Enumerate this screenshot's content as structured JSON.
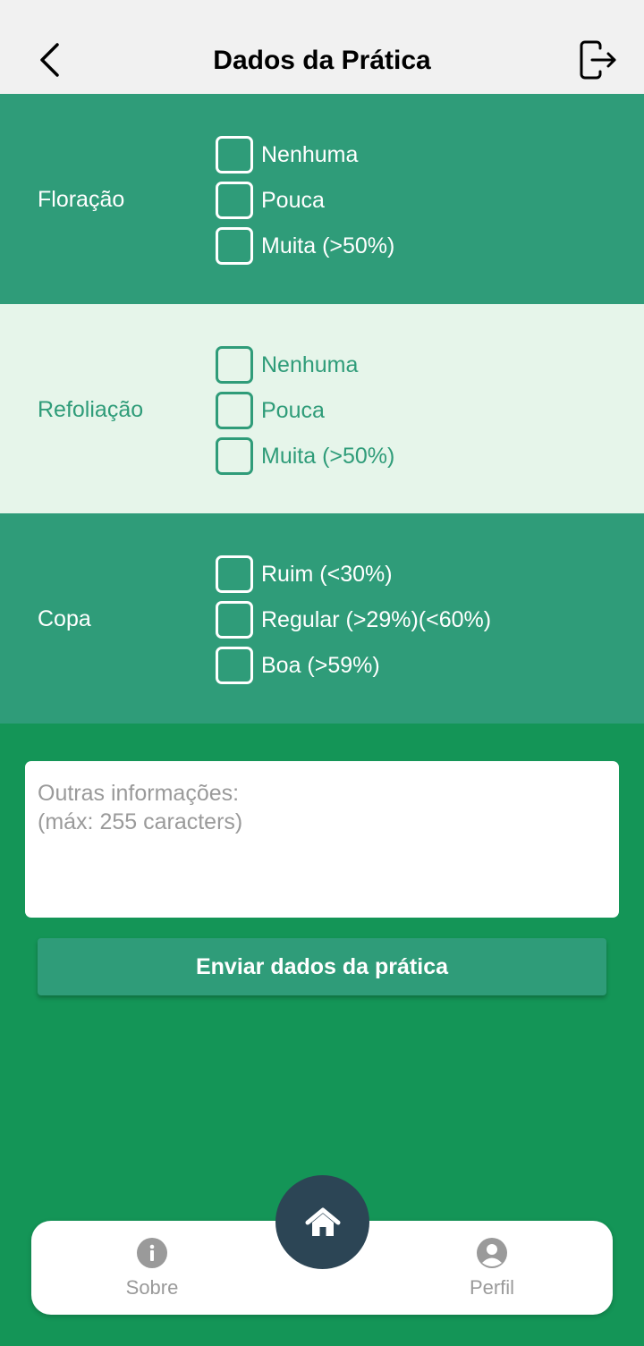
{
  "header": {
    "title": "Dados da Prática"
  },
  "sections": [
    {
      "label": "Floração",
      "options": [
        "Nenhuma",
        "Pouca",
        "Muita (>50%)"
      ]
    },
    {
      "label": "Refoliação",
      "options": [
        "Nenhuma",
        "Pouca",
        "Muita (>50%)"
      ]
    },
    {
      "label": "Copa",
      "options": [
        "Ruim (<30%)",
        "Regular (>29%)(<60%)",
        "Boa (>59%)"
      ]
    }
  ],
  "notes": {
    "placeholder": "Outras informações:\n(máx: 255 caracters)",
    "value": ""
  },
  "submit_label": "Enviar dados da prática",
  "bottom_nav": {
    "left_label": "Sobre",
    "right_label": "Perfil"
  },
  "colors": {
    "page_background": "#149557",
    "section_dark": "#2f9c79",
    "section_light": "#e6f5ea",
    "header_background": "#f1f1f1",
    "home_button": "#2c4555"
  },
  "icons": {
    "back": "chevron-left-icon",
    "logout": "logout-icon",
    "info": "info-icon",
    "home": "home-icon",
    "profile": "user-icon"
  }
}
